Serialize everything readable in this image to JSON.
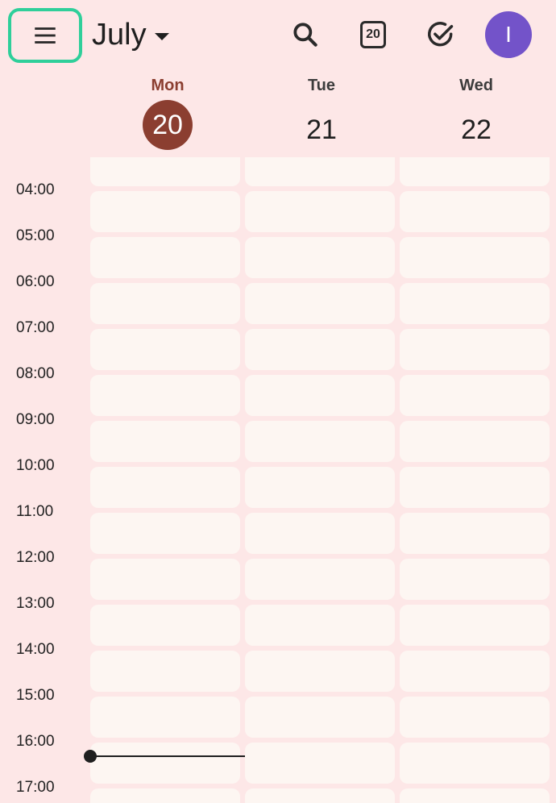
{
  "header": {
    "month_label": "July",
    "today_badge": "20",
    "avatar_initial": "I"
  },
  "days": [
    {
      "name": "Mon",
      "number": "20",
      "today": true
    },
    {
      "name": "Tue",
      "number": "21",
      "today": false
    },
    {
      "name": "Wed",
      "number": "22",
      "today": false
    }
  ],
  "times": [
    "04:00",
    "05:00",
    "06:00",
    "07:00",
    "08:00",
    "09:00",
    "10:00",
    "11:00",
    "12:00",
    "13:00",
    "14:00",
    "15:00",
    "16:00",
    "17:00"
  ],
  "colors": {
    "background": "#fde7e7",
    "cell": "#fdf6f2",
    "today_accent": "#8b3e30",
    "avatar": "#7353c9",
    "highlight": "#2fcf9a"
  }
}
